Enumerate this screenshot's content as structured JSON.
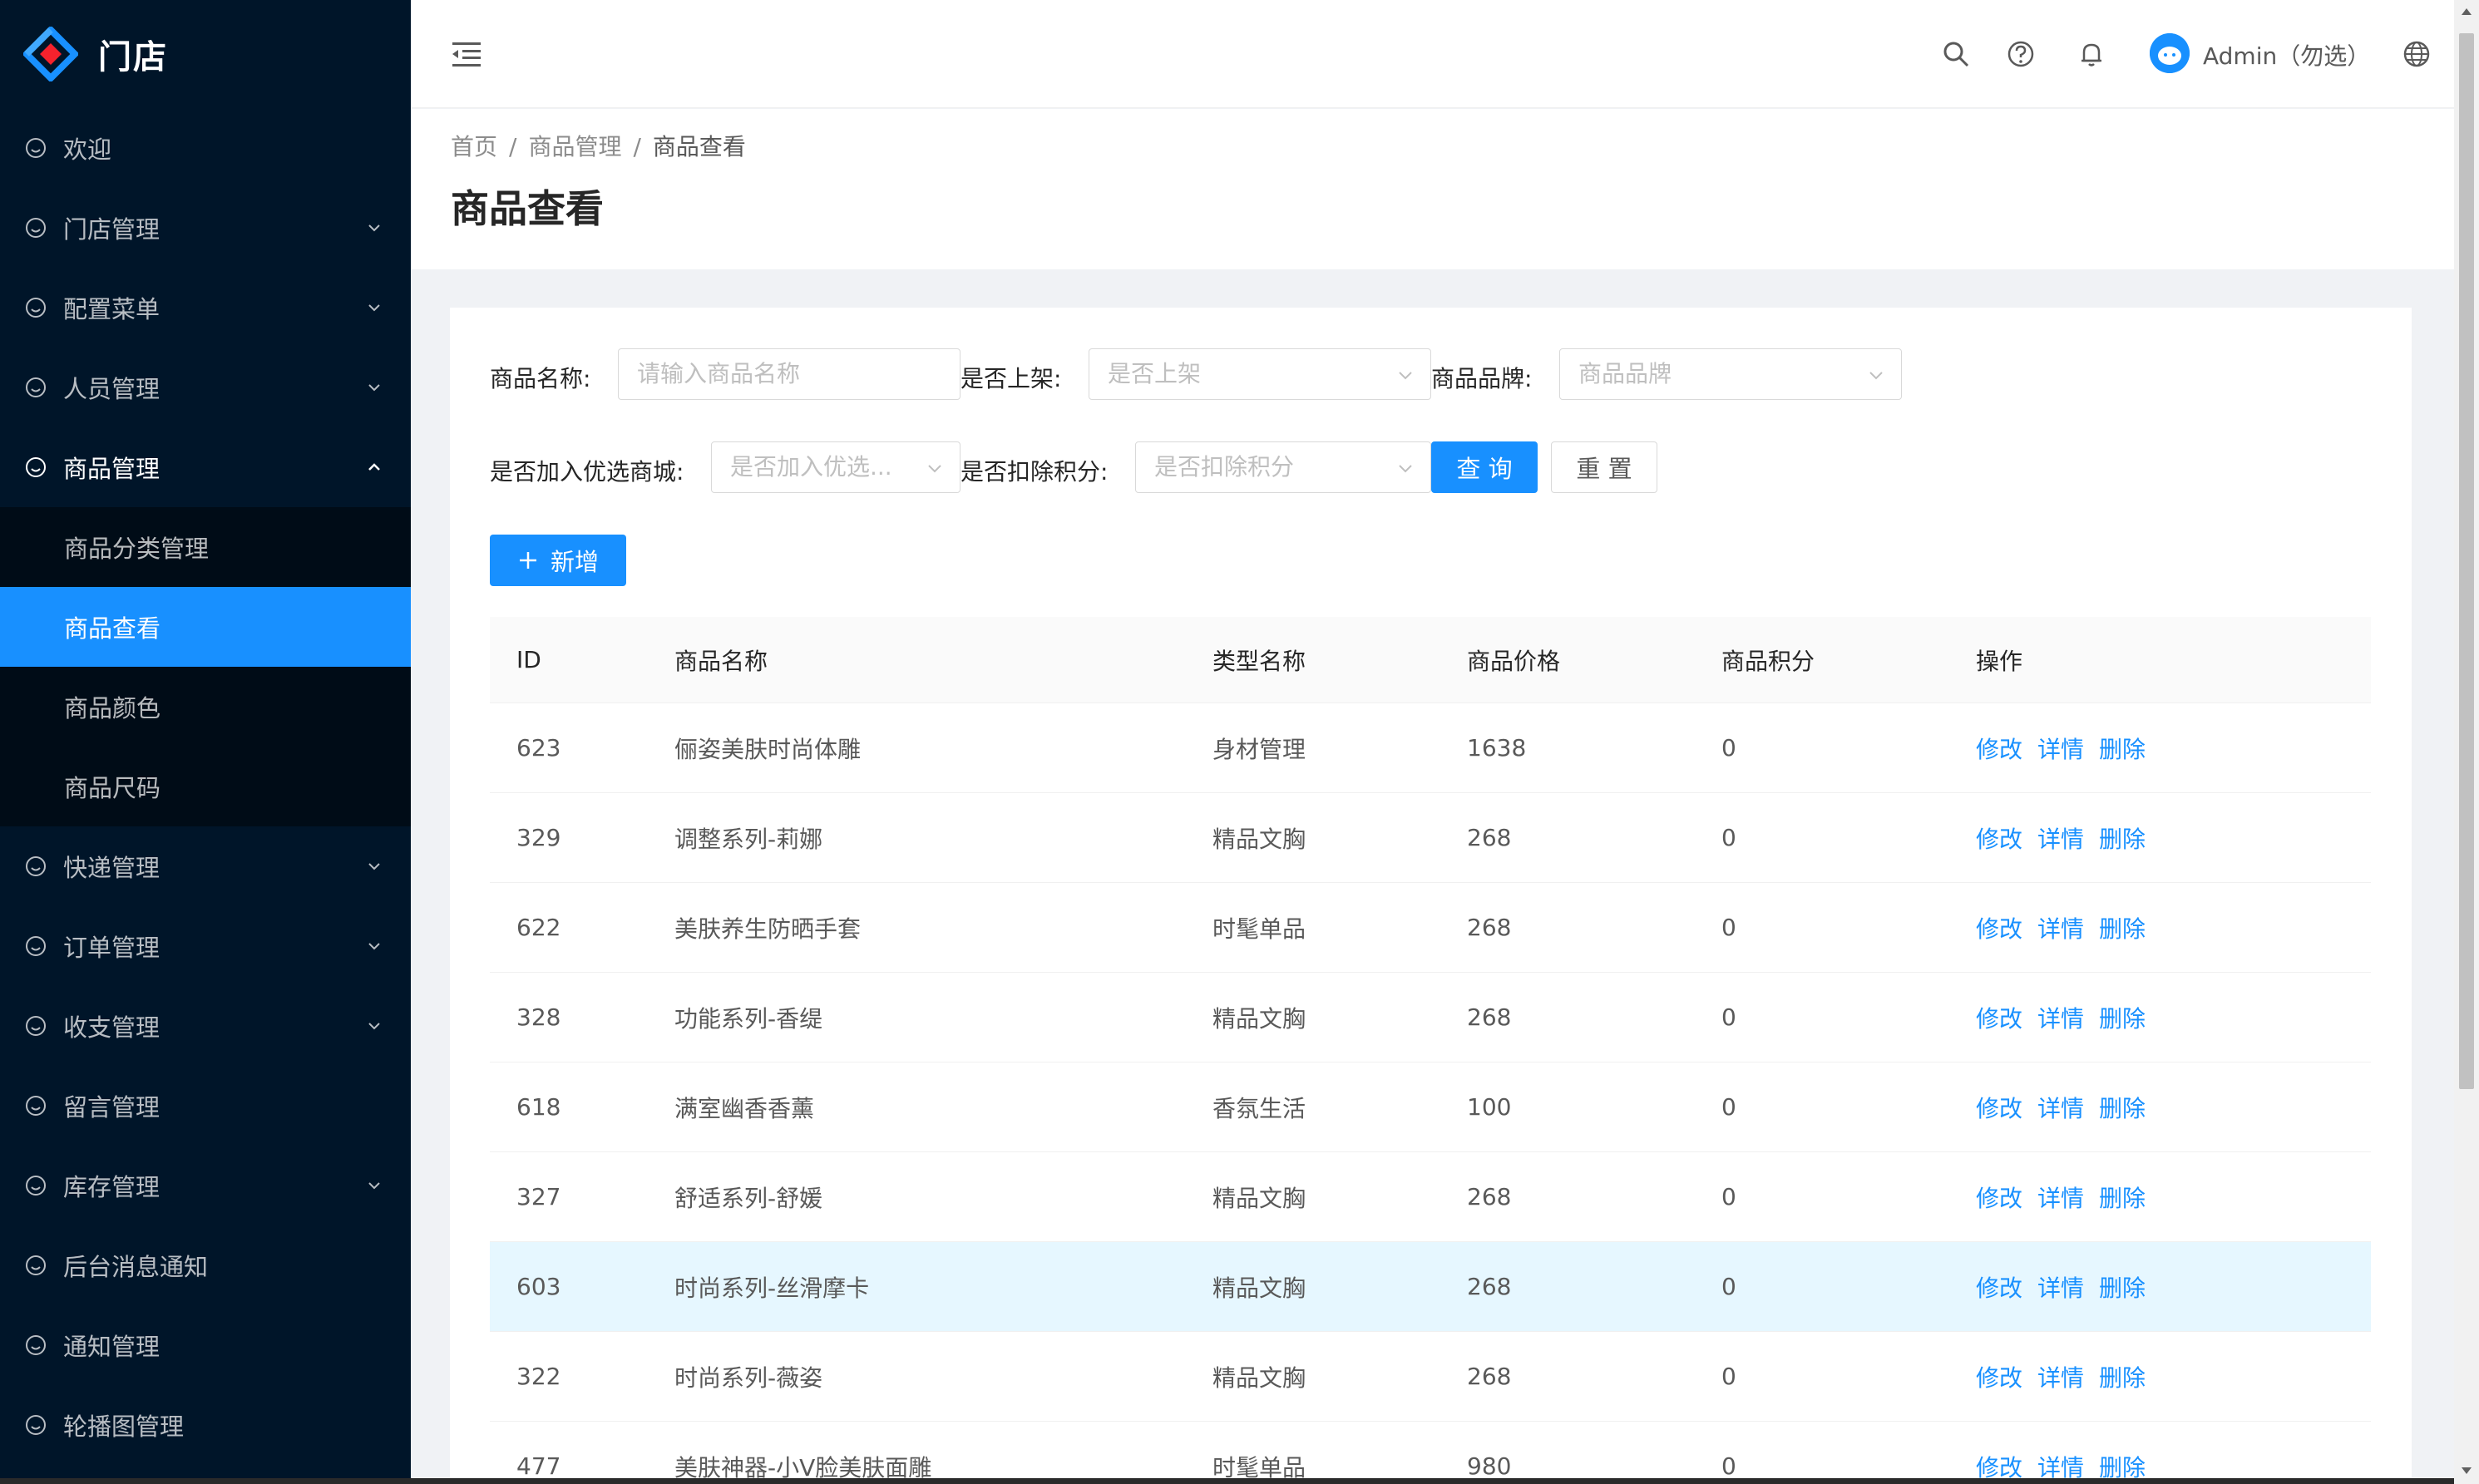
{
  "app": {
    "logo_title": "门店"
  },
  "sidebar": {
    "items": [
      {
        "label": "欢迎",
        "has_children": false
      },
      {
        "label": "门店管理",
        "has_children": true
      },
      {
        "label": "配置菜单",
        "has_children": true
      },
      {
        "label": "人员管理",
        "has_children": true
      },
      {
        "label": "商品管理",
        "has_children": true,
        "open": true
      },
      {
        "label": "快递管理",
        "has_children": true
      },
      {
        "label": "订单管理",
        "has_children": true
      },
      {
        "label": "收支管理",
        "has_children": true
      },
      {
        "label": "留言管理",
        "has_children": false
      },
      {
        "label": "库存管理",
        "has_children": true
      },
      {
        "label": "后台消息通知",
        "has_children": false
      },
      {
        "label": "通知管理",
        "has_children": false
      },
      {
        "label": "轮播图管理",
        "has_children": false
      }
    ],
    "submenu": [
      {
        "label": "商品分类管理",
        "active": false
      },
      {
        "label": "商品查看",
        "active": true
      },
      {
        "label": "商品颜色",
        "active": false
      },
      {
        "label": "商品尺码",
        "active": false
      }
    ]
  },
  "header": {
    "user_name": "Admin（勿选）"
  },
  "breadcrumb": [
    "首页",
    "商品管理",
    "商品查看"
  ],
  "page_title": "商品查看",
  "filters": {
    "name_label": "商品名称:",
    "name_placeholder": "请输入商品名称",
    "onshelf_label": "是否上架:",
    "onshelf_placeholder": "是否上架",
    "brand_label": "商品品牌:",
    "brand_placeholder": "商品品牌",
    "featured_label": "是否加入优选商城:",
    "featured_placeholder": "是否加入优选...",
    "points_label": "是否扣除积分:",
    "points_placeholder": "是否扣除积分",
    "query_label": "查 询",
    "reset_label": "重 置",
    "add_label": "新增"
  },
  "table": {
    "columns": [
      "ID",
      "商品名称",
      "类型名称",
      "商品价格",
      "商品积分",
      "操作"
    ],
    "actions": [
      "修改",
      "详情",
      "删除"
    ],
    "rows": [
      {
        "id": "623",
        "name": "俪姿美肤时尚体雕",
        "type": "身材管理",
        "price": "1638",
        "points": "0"
      },
      {
        "id": "329",
        "name": "调整系列-莉娜",
        "type": "精品文胸",
        "price": "268",
        "points": "0"
      },
      {
        "id": "622",
        "name": "美肤养生防晒手套",
        "type": "时髦单品",
        "price": "268",
        "points": "0"
      },
      {
        "id": "328",
        "name": "功能系列-香缇",
        "type": "精品文胸",
        "price": "268",
        "points": "0"
      },
      {
        "id": "618",
        "name": "满室幽香香薰",
        "type": "香氛生活",
        "price": "100",
        "points": "0"
      },
      {
        "id": "327",
        "name": "舒适系列-舒媛",
        "type": "精品文胸",
        "price": "268",
        "points": "0"
      },
      {
        "id": "603",
        "name": "时尚系列-丝滑摩卡",
        "type": "精品文胸",
        "price": "268",
        "points": "0",
        "highlight": true
      },
      {
        "id": "322",
        "name": "时尚系列-薇姿",
        "type": "精品文胸",
        "price": "268",
        "points": "0"
      },
      {
        "id": "477",
        "name": "美肤神器-小V脸美肤面雕",
        "type": "时髦单品",
        "price": "980",
        "points": "0"
      }
    ]
  },
  "colors": {
    "primary": "#1890ff",
    "sidebar_bg": "#001529",
    "submenu_bg": "#000c17",
    "row_highlight": "#e6f7ff"
  }
}
